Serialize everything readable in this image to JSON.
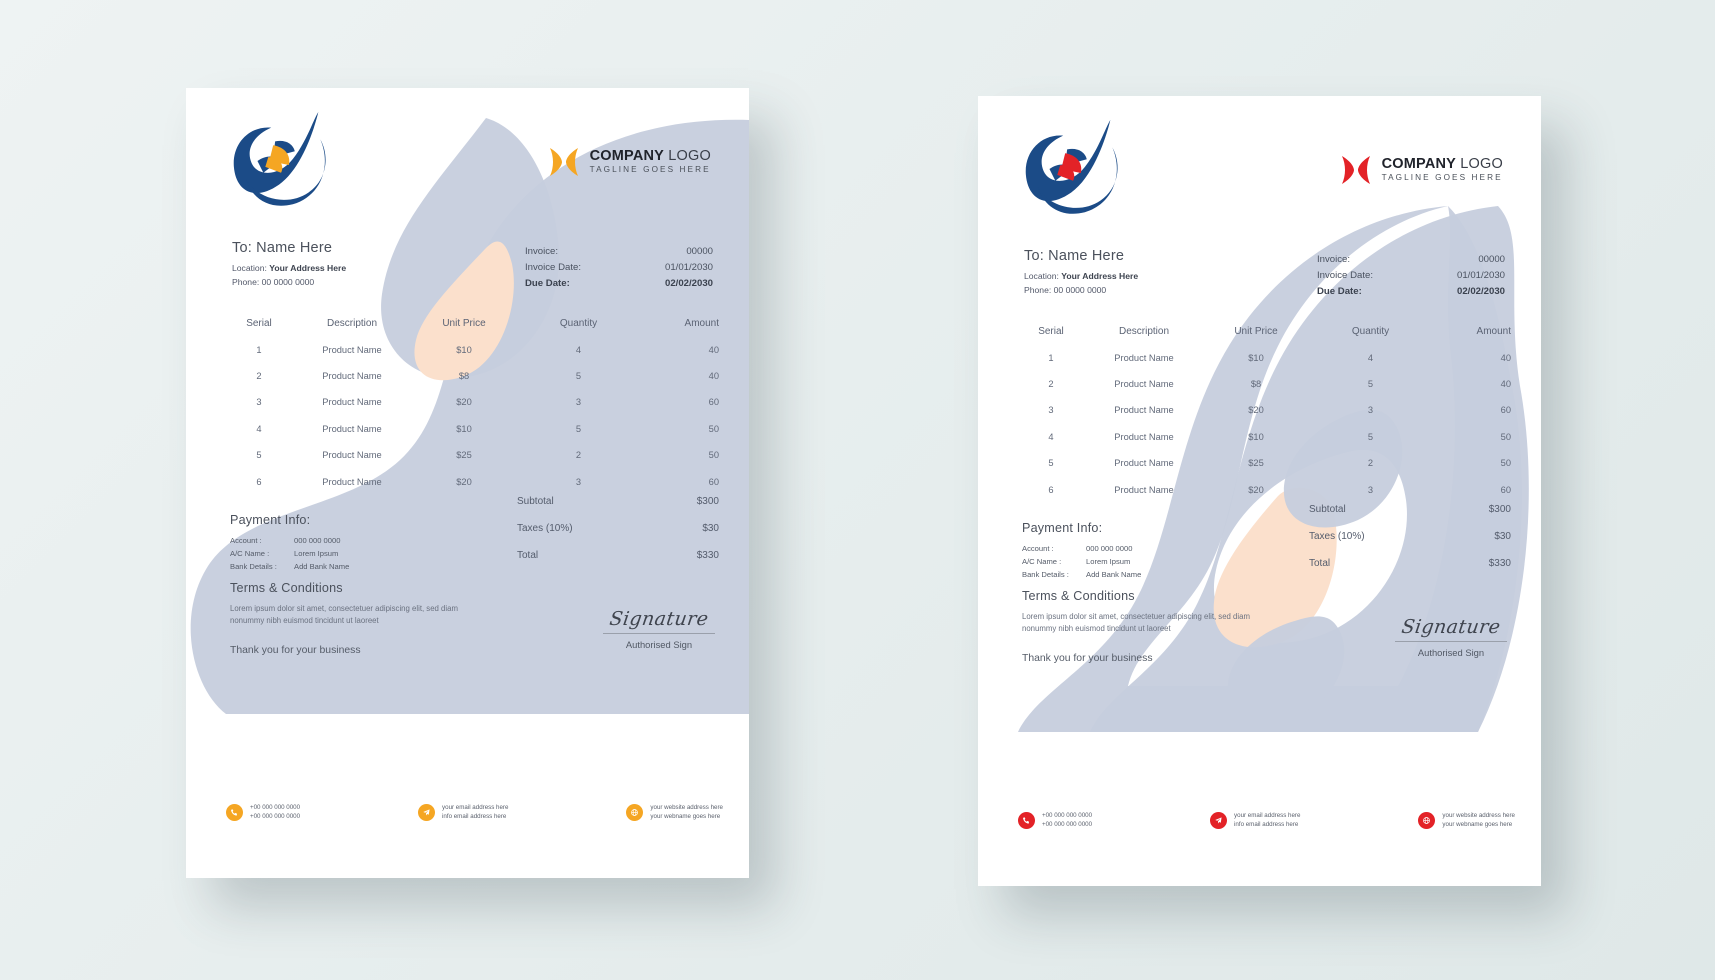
{
  "theme": {
    "accent_left": "#F5A623",
    "accent_right": "#E32227",
    "brand_navy": "#1B4B87",
    "blob_grey": "#C6CEDD",
    "blob_peach": "#FBE0CC",
    "paper": "#FFFFFF",
    "background": "#E7EEEE"
  },
  "logo": {
    "name_bold": "COMPANY",
    "name_light": "LOGO",
    "tagline": "TAGLINE GOES HERE",
    "mark_icon": "bowtie-logo-icon",
    "brandmark_icon": "swoosh-brandmark-icon"
  },
  "bill_to": {
    "name": "To: Name Here",
    "location_label": "Location:",
    "location_value": "Your Address Here",
    "phone_label": "Phone:",
    "phone_value": "00 0000 0000"
  },
  "meta": [
    {
      "label": "Invoice:",
      "value": "00000",
      "bold": false
    },
    {
      "label": "Invoice Date:",
      "value": "01/01/2030",
      "bold": false
    },
    {
      "label": "Due Date:",
      "value": "02/02/2030",
      "bold": true
    }
  ],
  "table": {
    "columns": [
      "Serial",
      "Description",
      "Unit Price",
      "Quantity",
      "Amount"
    ],
    "rows": [
      {
        "serial": "1",
        "description": "Product Name",
        "unit_price": "$10",
        "quantity": "4",
        "amount": "40"
      },
      {
        "serial": "2",
        "description": "Product Name",
        "unit_price": "$8",
        "quantity": "5",
        "amount": "40"
      },
      {
        "serial": "3",
        "description": "Product Name",
        "unit_price": "$20",
        "quantity": "3",
        "amount": "60"
      },
      {
        "serial": "4",
        "description": "Product Name",
        "unit_price": "$10",
        "quantity": "5",
        "amount": "50"
      },
      {
        "serial": "5",
        "description": "Product Name",
        "unit_price": "$25",
        "quantity": "2",
        "amount": "50"
      },
      {
        "serial": "6",
        "description": "Product Name",
        "unit_price": "$20",
        "quantity": "3",
        "amount": "60"
      }
    ]
  },
  "totals": [
    {
      "label": "Subtotal",
      "value": "$300"
    },
    {
      "label": "Taxes (10%)",
      "value": "$30"
    },
    {
      "label": "Total",
      "value": "$330"
    }
  ],
  "payment_info": {
    "title": "Payment Info:",
    "lines": [
      {
        "key": "Account :",
        "value": "000 000 0000"
      },
      {
        "key": "A/C Name :",
        "value": "Lorem Ipsum"
      },
      {
        "key": "Bank Details :",
        "value": "Add Bank Name"
      }
    ]
  },
  "terms": {
    "title": "Terms & Conditions",
    "body": "Lorem ipsum dolor sit amet, consectetuer adipiscing elit, sed diam nonummy nibh euismod tincidunt ut laoreet",
    "thanks": "Thank you for your business"
  },
  "signature": {
    "script": "Signature",
    "label": "Authorised Sign"
  },
  "footer": [
    {
      "icon": "phone-icon",
      "line1": "+00 000 000 0000",
      "line2": "+00 000 000 0000"
    },
    {
      "icon": "email-send-icon",
      "line1": "your email address here",
      "line2": "info email address here"
    },
    {
      "icon": "globe-icon",
      "line1": "your website address here",
      "line2": "your webname goes here"
    }
  ]
}
